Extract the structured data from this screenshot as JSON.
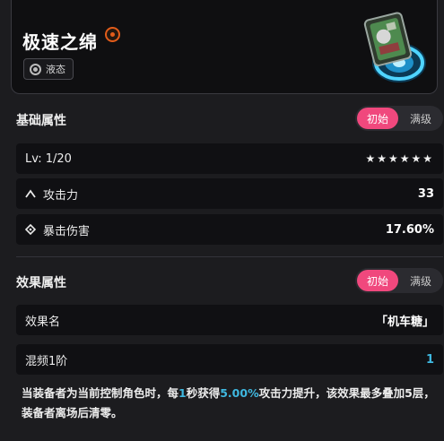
{
  "item": {
    "name": "极速之绵",
    "attribute": "液态",
    "rarity_color": "#e25c1a"
  },
  "base_section": {
    "title": "基础属性",
    "toggle": {
      "active": "初始",
      "inactive": "满级"
    },
    "level": {
      "label": "Lv: 1/20",
      "stars": "★★★★★★",
      "star_count": 6
    },
    "stats": [
      {
        "icon": "attack-icon",
        "label": "攻击力",
        "value": "33"
      },
      {
        "icon": "crit-damage-icon",
        "label": "暴击伤害",
        "value": "17.60%"
      }
    ]
  },
  "effect_section": {
    "title": "效果属性",
    "toggle": {
      "active": "初始",
      "inactive": "满级"
    },
    "effect_name_label": "效果名",
    "effect_name_value": "「机车糖」",
    "rank_label": "混频1阶",
    "rank_value": "1",
    "description": {
      "part1": "当装备者为当前控制角色时，每",
      "num1": "1",
      "part2": "秒获得",
      "num2": "5.00%",
      "part3": "攻击力提升，该效果最多叠加5层，装备者离场后清零。"
    }
  },
  "colors": {
    "accent_pink": "#f0487d",
    "highlight_blue": "#3fb8e0"
  }
}
